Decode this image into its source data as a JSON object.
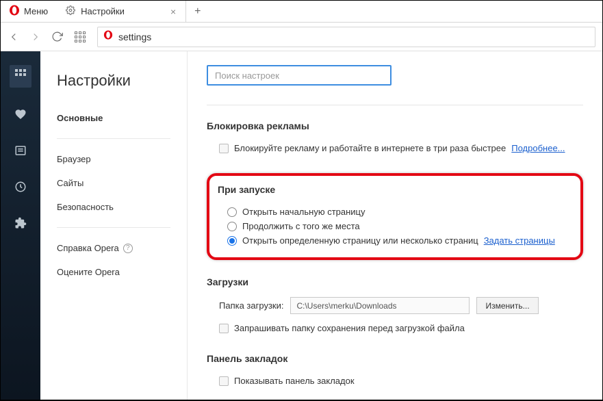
{
  "titlebar": {
    "menu_label": "Меню",
    "tab_label": "Настройки"
  },
  "toolbar": {
    "address_text": "settings"
  },
  "sidebar": {
    "title": "Настройки",
    "items": [
      "Основные",
      "Браузер",
      "Сайты",
      "Безопасность"
    ],
    "help": "Справка Opera",
    "rate": "Оцените Opera"
  },
  "search": {
    "placeholder": "Поиск настроек"
  },
  "sections": {
    "ad_block": {
      "title": "Блокировка рекламы",
      "checkbox_label": "Блокируйте рекламу и работайте в интернете в три раза быстрее",
      "link": "Подробнее..."
    },
    "startup": {
      "title": "При запуске",
      "opt1": "Открыть начальную страницу",
      "opt2": "Продолжить с того же места",
      "opt3": "Открыть определенную страницу или несколько страниц",
      "link": "Задать страницы",
      "selected": 3
    },
    "downloads": {
      "title": "Загрузки",
      "folder_label": "Папка загрузки:",
      "folder_value": "C:\\Users\\merku\\Downloads",
      "change_btn": "Изменить...",
      "ask_label": "Запрашивать папку сохранения перед загрузкой файла"
    },
    "bookmarks_bar": {
      "title": "Панель закладок",
      "show_label": "Показывать панель закладок"
    }
  }
}
